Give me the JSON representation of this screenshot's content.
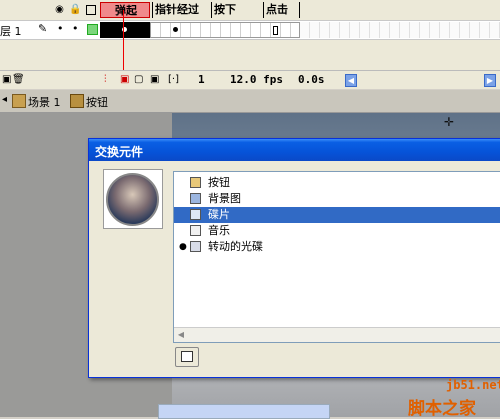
{
  "timeline": {
    "layer_name": "层 1",
    "frame_labels": [
      "弹起",
      "指针经过",
      "按下",
      "点击"
    ],
    "current_frame": "1",
    "fps": "12.0 fps",
    "elapsed": "0.0s"
  },
  "edit_bar": {
    "scene": "场景 1",
    "symbol": "按钮"
  },
  "dialog": {
    "title": "交换元件",
    "items": [
      {
        "label": "按钮",
        "icon": "button-symbol-icon",
        "bullet": false,
        "selected": false
      },
      {
        "label": "背景图",
        "icon": "bitmap-icon",
        "bullet": false,
        "selected": false
      },
      {
        "label": "碟片",
        "icon": "graphic-symbol-icon",
        "bullet": false,
        "selected": true
      },
      {
        "label": "音乐",
        "icon": "sound-icon",
        "bullet": false,
        "selected": false
      },
      {
        "label": "转动的光碟",
        "icon": "movieclip-symbol-icon",
        "bullet": true,
        "selected": false
      }
    ]
  },
  "watermark": {
    "site": "jb51.net",
    "name": "脚本之家"
  },
  "colors": {
    "selection": "#316ac5",
    "titlebar": "#0653d8",
    "up_frame_label": "#f08a8a",
    "watermark": "#e06000"
  }
}
